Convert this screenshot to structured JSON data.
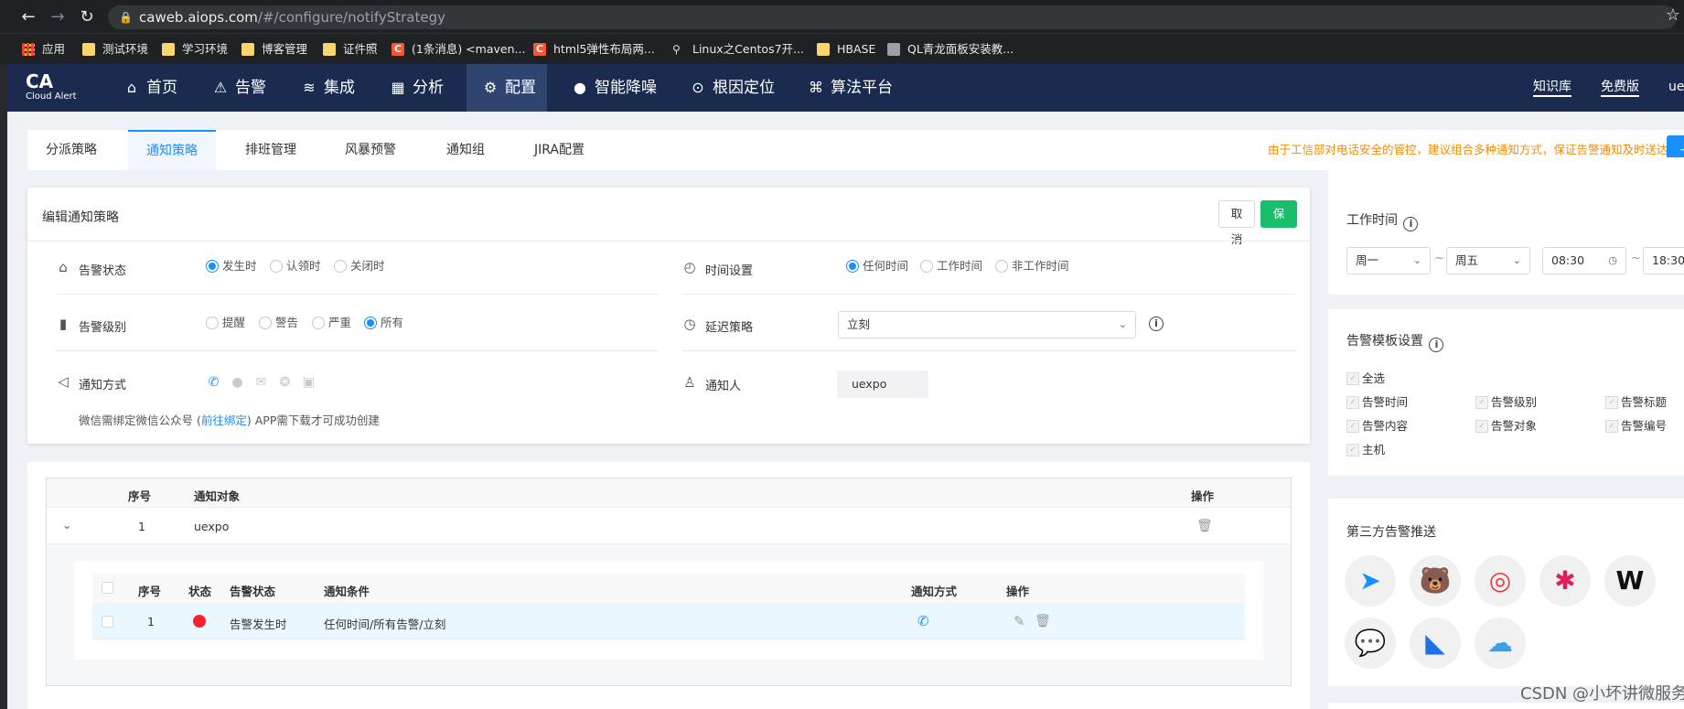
{
  "browser": {
    "url_host": "caweb.aiops.com",
    "url_path": "/#/configure/notifyStrategy",
    "bookmarks": [
      "应用",
      "测试环境",
      "学习环境",
      "博客管理",
      "证件照",
      "(1条消息) <maven...",
      "html5弹性布局两...",
      "Linux之Centos7开...",
      "HBASE",
      "QL青龙面板安装教..."
    ]
  },
  "header": {
    "logo_title": "CA",
    "logo_subtitle": "Cloud Alert",
    "menu": [
      {
        "label": "首页",
        "icon": "home-icon"
      },
      {
        "label": "告警",
        "icon": "alarm-icon"
      },
      {
        "label": "集成",
        "icon": "layers-icon"
      },
      {
        "label": "分析",
        "icon": "chart-icon"
      },
      {
        "label": "配置",
        "icon": "gear-icon"
      },
      {
        "label": "智能降噪",
        "icon": "noise-icon"
      },
      {
        "label": "根因定位",
        "icon": "target-icon"
      },
      {
        "label": "算法平台",
        "icon": "algorithm-icon"
      }
    ],
    "active_menu": "配置",
    "links": [
      "知识库",
      "免费版"
    ],
    "user": "ue"
  },
  "tabs": [
    "分派策略",
    "通知策略",
    "排班管理",
    "风暴预警",
    "通知组",
    "JIRA配置"
  ],
  "active_tab": "通知策略",
  "notice": "由于工信部对电话安全的管控，建议组合多种通知方式，保证告警通知及时送达。",
  "new_button": "+ 新",
  "edit": {
    "title": "编辑通知策略",
    "cancel": "取消",
    "save": "保存",
    "alarm_status_label": "告警状态",
    "alarm_status_options": [
      "发生时",
      "认领时",
      "关闭时"
    ],
    "alarm_status_selected": "发生时",
    "alarm_level_label": "告警级别",
    "alarm_level_options": [
      "提醒",
      "警告",
      "严重",
      "所有"
    ],
    "alarm_level_selected": "所有",
    "notify_method_label": "通知方式",
    "time_label": "时间设置",
    "time_options": [
      "任何时间",
      "工作时间",
      "非工作时间"
    ],
    "time_selected": "任何时间",
    "delay_label": "延迟策略",
    "delay_value": "立刻",
    "notifier_label": "通知人",
    "notifier_value": "uexpo",
    "hint_prefix": "微信需绑定微信公众号 (",
    "hint_link": "前往绑定",
    "hint_suffix": ") APP需下载才可成功创建"
  },
  "table": {
    "headers": [
      "序号",
      "通知对象",
      "操作"
    ],
    "row": {
      "index": "1",
      "target": "uexpo"
    },
    "sub_headers": [
      "序号",
      "状态",
      "告警状态",
      "通知条件",
      "通知方式",
      "操作"
    ],
    "sub_row": {
      "index": "1",
      "status_color": "#f5222d",
      "alarm_status": "告警发生时",
      "condition": "任何时间/所有告警/立刻"
    }
  },
  "worktime": {
    "title": "工作时间",
    "from_day": "周一",
    "to_day": "周五",
    "from_time": "08:30",
    "to_time": "18:30",
    "separator": "~"
  },
  "template": {
    "title": "告警模板设置",
    "select_all": "全选",
    "fields": [
      "告警时间",
      "告警级别",
      "告警标题",
      "告警内容",
      "告警对象",
      "告警编号",
      "主机"
    ]
  },
  "third_party": {
    "title": "第三方告警推送",
    "apps": [
      {
        "name": "dingtalk-icon",
        "glyph": "➤",
        "color": "#1890ff"
      },
      {
        "name": "bear-icon",
        "glyph": "🐻",
        "color": "#2bb673"
      },
      {
        "name": "ring-icon",
        "glyph": "◎",
        "color": "#e8383d"
      },
      {
        "name": "slack-icon",
        "glyph": "✱",
        "color": "#e01e5a"
      },
      {
        "name": "w-icon",
        "glyph": "W",
        "color": "#111111"
      },
      {
        "name": "chat-icon",
        "glyph": "💬",
        "color": "#1890ff"
      },
      {
        "name": "feishu-icon",
        "glyph": "◣",
        "color": "#1f6feb"
      },
      {
        "name": "cloud-icon",
        "glyph": "☁",
        "color": "#3aa0e8"
      }
    ]
  },
  "watermark": "CSDN @小坏讲微服务"
}
